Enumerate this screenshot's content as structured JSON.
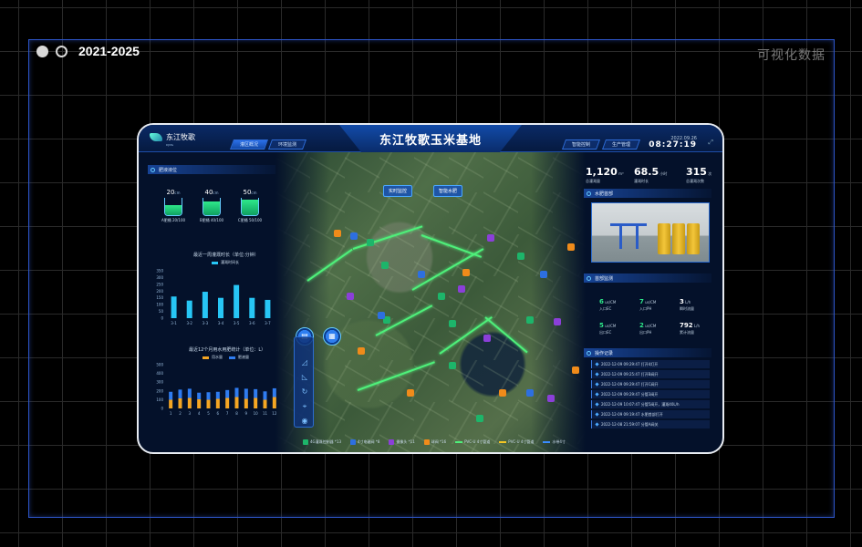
{
  "page": {
    "year_range": "2021-2025",
    "corner_title": "可视化数据"
  },
  "header": {
    "logo_text": "东江牧歌",
    "logo_sub": "DJMG",
    "title": "东江牧歌玉米基地",
    "nav_left": [
      "灌区概况",
      "环境监测"
    ],
    "nav_right": [
      "智能控制",
      "生产管理"
    ],
    "date": "2022.09.26",
    "time": "08:27:19"
  },
  "left": {
    "tanks_title": "肥液液位",
    "tanks": [
      {
        "value": "20",
        "unit": "cm",
        "label": "A肥桶 20/100",
        "level": 0.2
      },
      {
        "value": "40",
        "unit": "cm",
        "label": "B肥桶 40/100",
        "level": 0.4
      },
      {
        "value": "50",
        "unit": "cm",
        "label": "C肥桶 50/100",
        "level": 0.5
      }
    ],
    "chart1_title": "最近一周灌溉时长（单位:分钟）",
    "chart1_legend": "灌溉时间长",
    "chart2_title": "最近12个月用水用肥统计（单位：L）",
    "chart2_legend": [
      "用水量",
      "肥液量"
    ]
  },
  "chart_data": [
    {
      "type": "bar",
      "title": "最近一周灌溉时长（单位:分钟）",
      "categories": [
        "3-1",
        "3-2",
        "3-3",
        "3-4",
        "3-5",
        "3-6",
        "3-7"
      ],
      "series": [
        {
          "name": "灌溉时间长",
          "values": [
            160,
            130,
            195,
            150,
            245,
            150,
            135
          ]
        }
      ],
      "yticks": [
        0,
        50,
        100,
        150,
        200,
        250,
        300,
        350
      ],
      "ylim": [
        0,
        350
      ],
      "color": "#27c6f5"
    },
    {
      "type": "bar",
      "title": "最近12个月用水用肥统计（单位：L）",
      "categories": [
        "1",
        "2",
        "3",
        "4",
        "5",
        "6",
        "7",
        "8",
        "9",
        "10",
        "11",
        "12"
      ],
      "series": [
        {
          "name": "用水量",
          "values": [
            200,
            230,
            240,
            210,
            200,
            220,
            240,
            260,
            220,
            240,
            200,
            260
          ]
        },
        {
          "name": "肥液量",
          "values": [
            180,
            200,
            210,
            150,
            170,
            160,
            180,
            210,
            230,
            200,
            190,
            200
          ]
        }
      ],
      "stacked": true,
      "yticks": [
        0,
        100,
        200,
        300,
        400,
        500
      ],
      "ylim": [
        0,
        500
      ],
      "colors": [
        "#f5a623",
        "#2f7cf0"
      ]
    }
  ],
  "right": {
    "stats": [
      {
        "value": "1,120",
        "unit": "m³",
        "label": "总灌溉量"
      },
      {
        "value": "68.5",
        "unit": "小时",
        "label": "灌溉时长"
      },
      {
        "value": "315",
        "unit": "次",
        "label": "总灌溉次数"
      }
    ],
    "photo_title": "水肥首部",
    "head_title": "首部监测",
    "metrics": [
      {
        "value": "6",
        "unit": "us/CM",
        "label": "入口EC",
        "green": true
      },
      {
        "value": "7",
        "unit": "us/CM",
        "label": "入口PH",
        "green": true
      },
      {
        "value": "3",
        "unit": "L/h",
        "label": "瞬时流量",
        "green": false
      },
      {
        "value": "5",
        "unit": "us/CM",
        "label": "出口EC",
        "green": true
      },
      {
        "value": "2",
        "unit": "us/CM",
        "label": "出口PH",
        "green": true
      },
      {
        "value": "792",
        "unit": "L/h",
        "label": "累计流量",
        "green": false
      }
    ],
    "log_title": "操作记录",
    "logs": [
      "2022-12-09 09:29:47 打开4灯开",
      "2022-12-09 09:25:47 打开B阀开",
      "2022-12-09 09:29:47 打开C阀开",
      "2022-12-09 09:29:47 分管3阀开",
      "2022-12-09 10:07:47 分管5阀开，灌溉40L/h",
      "2022-12-09 09:19:47 水肥首部打开",
      "2022-12-08 21:59:07 分管A阀关"
    ]
  },
  "map": {
    "btn_monitor": "实时监控",
    "btn_water": "智能水肥"
  },
  "bottom_legend": [
    {
      "label": "4G灌溉控制器 *13",
      "kind": "box",
      "color": "#1db56a"
    },
    {
      "label": "4寸电磁阀 *8",
      "kind": "box",
      "color": "#2d6fe0"
    },
    {
      "label": "摄像头 *11",
      "kind": "box",
      "color": "#8b3fd9"
    },
    {
      "label": "球阀 *16",
      "kind": "box",
      "color": "#f08b1a"
    },
    {
      "label": "PVC-U 4寸管道",
      "kind": "line",
      "color": "#4ef07a"
    },
    {
      "label": "PVC-U 4寸管道",
      "kind": "line",
      "color": "#f5c623"
    },
    {
      "label": "水带4寸",
      "kind": "line",
      "color": "#3a8cff"
    }
  ]
}
